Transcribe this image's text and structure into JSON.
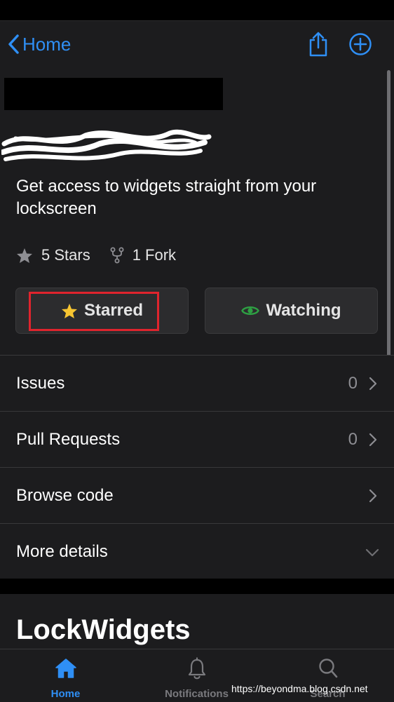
{
  "nav": {
    "back_label": "Home"
  },
  "repo": {
    "owner_name": "LockWidgets",
    "description": "Get access to widgets straight from your lockscreen",
    "stars": "5 Stars",
    "forks": "1 Fork"
  },
  "actions": {
    "star_label": "Starred",
    "watch_label": "Watching"
  },
  "menu": [
    {
      "label": "Issues",
      "count": "0"
    },
    {
      "label": "Pull Requests",
      "count": "0"
    },
    {
      "label": "Browse code",
      "count": ""
    },
    {
      "label": "More details",
      "count": ""
    }
  ],
  "readme": {
    "title": "LockWidgets"
  },
  "tabs": [
    {
      "label": "Home"
    },
    {
      "label": "Notifications"
    },
    {
      "label": "Search"
    }
  ],
  "watermark": "https://beyondma.blog.csdn.net",
  "colors": {
    "accent": "#2f8ff5",
    "highlight": "#e0242d",
    "star": "#f7c531",
    "watch": "#2ea043"
  },
  "icons": [
    "chevron-left-icon",
    "share-icon",
    "plus-circle-icon",
    "star-icon",
    "fork-icon",
    "eye-icon",
    "chevron-right-icon",
    "chevron-down-icon",
    "house-icon",
    "bell-icon",
    "magnifier-icon"
  ]
}
